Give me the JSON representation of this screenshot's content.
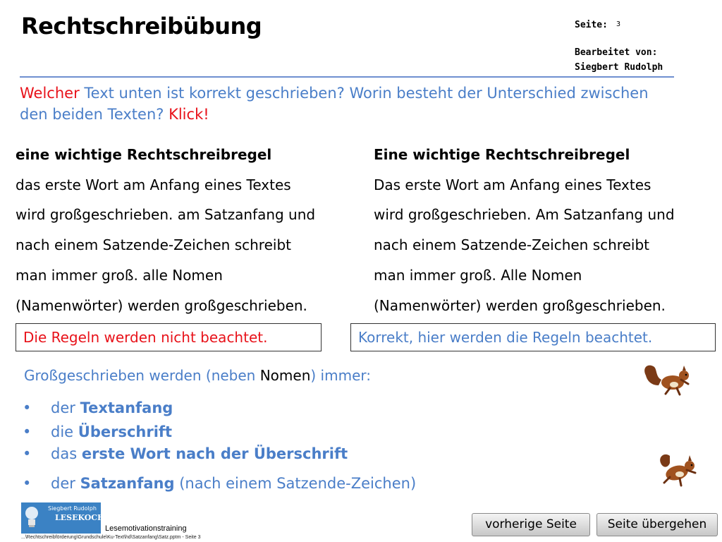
{
  "header": {
    "title": "Rechtschreibübung",
    "page_label": "Seite:",
    "page_number": "3",
    "edited_label": "Bearbeitet von:",
    "author": "Siegbert Rudolph"
  },
  "question": {
    "word1": "Welcher",
    "part2": " Text unten ist korrekt geschrieben? Worin besteht der Unterschied zwischen den beiden Texten? ",
    "click": "Klick!"
  },
  "left_text": {
    "heading": "eine wichtige Rechtschreibregel",
    "lines": [
      "das erste Wort am Anfang eines Textes",
      "wird großgeschrieben. am Satzanfang und",
      "nach einem Satzende-Zeichen schreibt",
      "man immer groß. alle Nomen",
      "(Namenwörter) werden großgeschrieben."
    ]
  },
  "right_text": {
    "heading": "Eine wichtige Rechtschreibregel",
    "lines": [
      "Das erste Wort am Anfang eines Textes",
      "wird großgeschrieben. Am Satzanfang und",
      "nach einem Satzende-Zeichen schreibt",
      "man immer groß. Alle Nomen",
      "(Namenwörter) werden großgeschrieben."
    ]
  },
  "answers": {
    "wrong": "Die Regeln werden nicht beachtet.",
    "right": "Korrekt, hier werden die Regeln beachtet."
  },
  "rules": {
    "intro_pre": "Großgeschrieben werden (neben ",
    "intro_noun": "Nomen",
    "intro_post": ") immer:",
    "bullet_char": "•",
    "items": [
      {
        "pre": "der ",
        "bold": "Textanfang",
        "post": ""
      },
      {
        "pre": "die ",
        "bold": "Überschrift",
        "post": ""
      },
      {
        "pre": "das ",
        "bold": "erste Wort nach der Überschrift",
        "post": ""
      },
      {
        "pre": "der ",
        "bold": "Satzanfang",
        "post": " (nach einem Satzende-Zeichen)"
      }
    ]
  },
  "footer": {
    "logo_line1": "Siegbert Rudolph",
    "logo_line2": "LESEKOCH",
    "training": "Lesemotivationstraining",
    "path": "...\\Rechtschreibförderung\\Grundschule\\Ku-Text\\hd\\Satzanfang\\Satz.pptm - Seite 3",
    "prev_button": "vorherige Seite",
    "skip_button": "Seite übergehen"
  },
  "colors": {
    "accent_blue": "#4a7ec8",
    "red": "#e8121a",
    "rule_line": "#6f8fd0"
  },
  "icons": [
    "squirrel-image",
    "bulb-logo-icon"
  ]
}
